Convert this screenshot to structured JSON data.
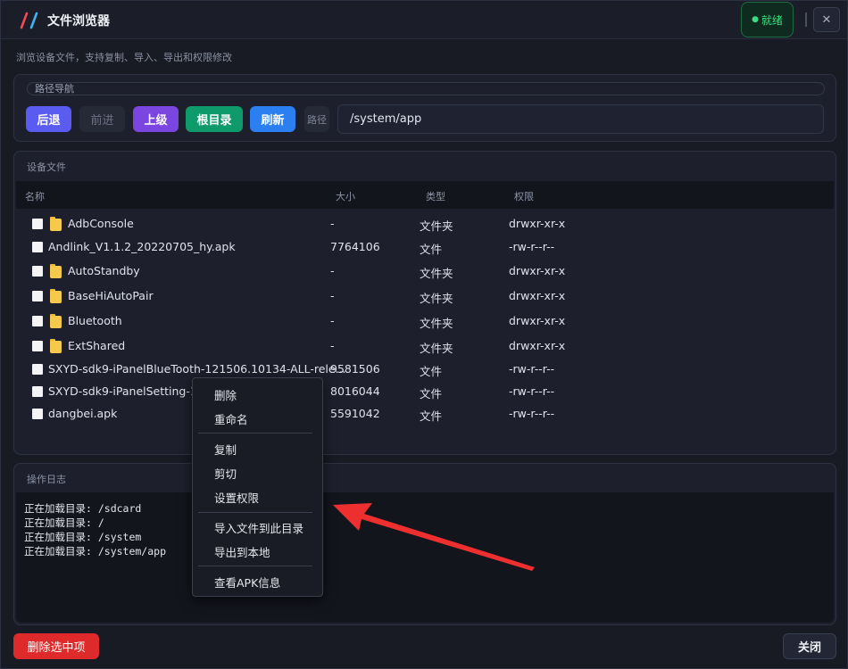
{
  "window": {
    "title": "文件浏览器",
    "status": "就绪",
    "close_glyph": "✕",
    "subtitle": "浏览设备文件，支持复制、导入、导出和权限修改"
  },
  "nav": {
    "legend": "路径导航",
    "back": "后退",
    "forward": "前进",
    "up": "上级",
    "root": "根目录",
    "refresh": "刷新",
    "path_label": "路径",
    "path_value": "/system/app"
  },
  "files": {
    "title": "设备文件",
    "columns": [
      "名称",
      "大小",
      "类型",
      "权限"
    ],
    "rows": [
      {
        "name": "AdbConsole",
        "size": "-",
        "type": "文件夹",
        "perm": "drwxr-xr-x",
        "folder": true
      },
      {
        "name": "Andlink_V1.1.2_20220705_hy.apk",
        "size": "7764106",
        "type": "文件",
        "perm": "-rw-r--r--",
        "folder": false
      },
      {
        "name": "AutoStandby",
        "size": "-",
        "type": "文件夹",
        "perm": "drwxr-xr-x",
        "folder": true
      },
      {
        "name": "BaseHiAutoPair",
        "size": "-",
        "type": "文件夹",
        "perm": "drwxr-xr-x",
        "folder": true
      },
      {
        "name": "Bluetooth",
        "size": "-",
        "type": "文件夹",
        "perm": "drwxr-xr-x",
        "folder": true
      },
      {
        "name": "ExtShared",
        "size": "-",
        "type": "文件夹",
        "perm": "drwxr-xr-x",
        "folder": true
      },
      {
        "name": "SXYD-sdk9-iPanelBlueTooth-121506.10134-ALL-rele...",
        "size": "9581506",
        "type": "文件",
        "perm": "-rw-r--r--",
        "folder": false
      },
      {
        "name": "SXYD-sdk9-iPanelSetting-10",
        "size": "8016044",
        "type": "文件",
        "perm": "-rw-r--r--",
        "folder": false
      },
      {
        "name": "dangbei.apk",
        "size": "5591042",
        "type": "文件",
        "perm": "-rw-r--r--",
        "folder": false
      }
    ]
  },
  "log": {
    "title": "操作日志",
    "lines": [
      "正在加载目录: /sdcard",
      "正在加载目录: /",
      "正在加载目录: /system",
      "正在加载目录: /system/app"
    ]
  },
  "context_menu": {
    "items": [
      "删除",
      "重命名",
      "复制",
      "剪切",
      "设置权限",
      "导入文件到此目录",
      "导出到本地",
      "查看APK信息"
    ]
  },
  "footer": {
    "delete_selected": "删除选中项",
    "close": "关闭"
  },
  "colors": {
    "accent_red": "#de2a2a",
    "status_green": "#3ddc84",
    "annotation_arrow": "#ee2f2f"
  }
}
